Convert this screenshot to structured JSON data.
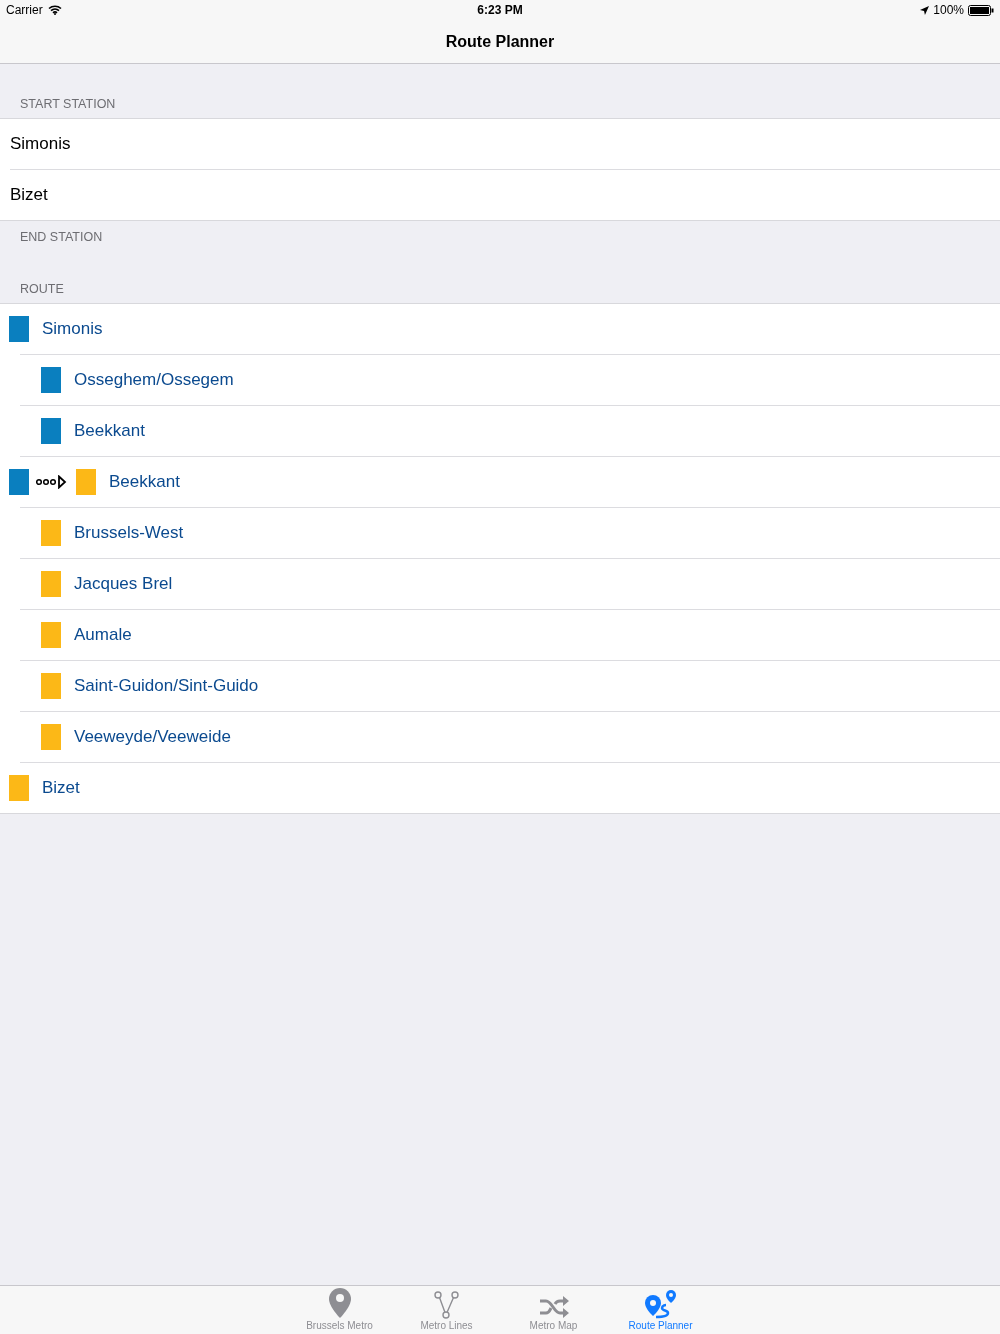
{
  "status_bar": {
    "carrier": "Carrier",
    "time": "6:23 PM",
    "battery": "100%"
  },
  "nav": {
    "title": "Route Planner"
  },
  "start_section": {
    "header": "START STATION",
    "rows": [
      "Simonis",
      "Bizet"
    ]
  },
  "end_section": {
    "header": "END STATION"
  },
  "route": {
    "header": "ROUTE",
    "items": [
      {
        "kind": "endpoint",
        "name": "Simonis",
        "color": "#0a7fbf"
      },
      {
        "kind": "stop",
        "name": "Osseghem/Ossegem",
        "color": "#0a7fbf"
      },
      {
        "kind": "stop",
        "name": "Beekkant",
        "color": "#0a7fbf"
      },
      {
        "kind": "transfer",
        "name": "Beekkant",
        "from": {
          "color": "#0a7fbf"
        },
        "color": "#fcb817"
      },
      {
        "kind": "stop",
        "name": "Brussels-West",
        "color": "#fcb817"
      },
      {
        "kind": "stop",
        "name": "Jacques Brel",
        "color": "#fcb817"
      },
      {
        "kind": "stop",
        "name": "Aumale",
        "color": "#fcb817"
      },
      {
        "kind": "stop",
        "name": "Saint-Guidon/Sint-Guido",
        "color": "#fcb817"
      },
      {
        "kind": "stop",
        "name": "Veeweyde/Veeweide",
        "color": "#fcb817"
      },
      {
        "kind": "endpoint",
        "name": "Bizet",
        "color": "#fcb817"
      }
    ]
  },
  "tabs": [
    {
      "kind": "pin",
      "label": "Brussels Metro",
      "selected": false
    },
    {
      "kind": "lines",
      "label": "Metro Lines",
      "selected": false
    },
    {
      "kind": "shuffle",
      "label": "Metro Map",
      "selected": false
    },
    {
      "kind": "route",
      "label": "Route Planner",
      "selected": true
    }
  ]
}
